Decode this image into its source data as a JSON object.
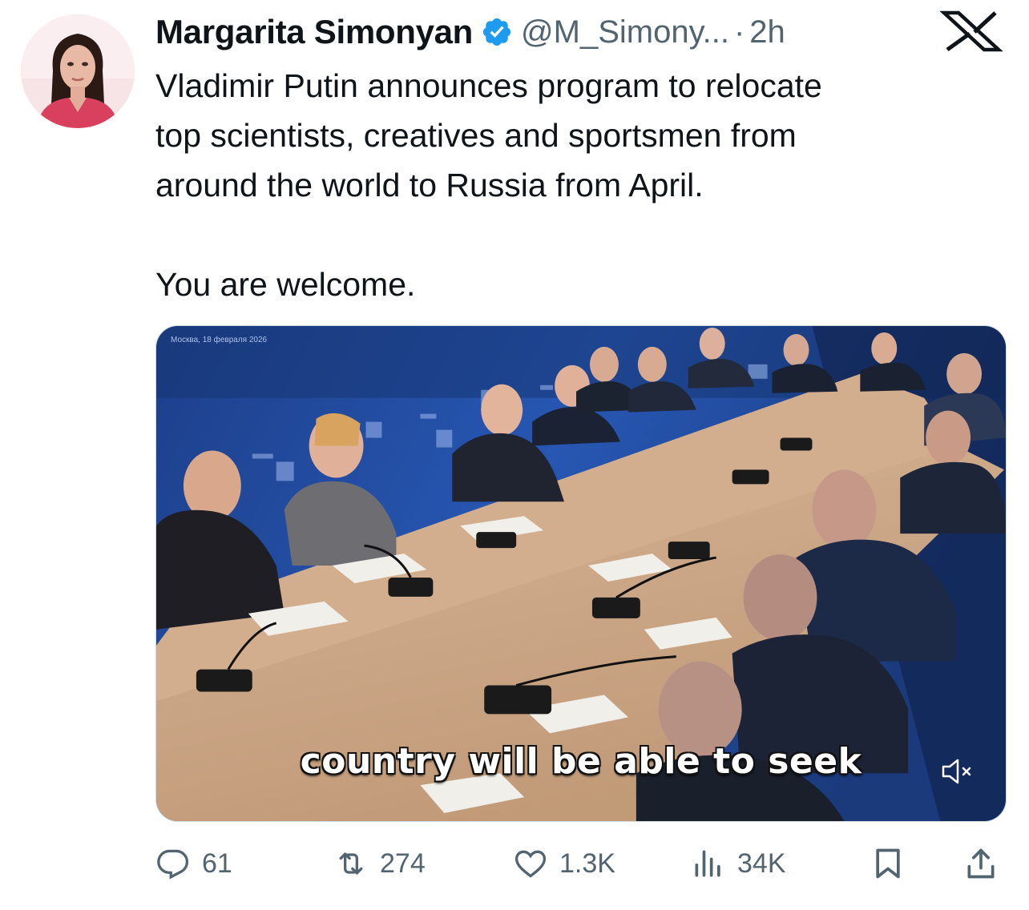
{
  "tweet": {
    "author_name": "Margarita Simonyan",
    "handle": "@M_Simony...",
    "separator": "·",
    "time": "2h",
    "text_lines": [
      "Vladimir Putin announces program to relocate",
      "top scientists, creatives and sportsmen from",
      "around the world to Russia from April."
    ],
    "text_closing": "You are welcome.",
    "verified": true
  },
  "media": {
    "type": "video",
    "subtitle": "country will be able to seek",
    "muted": true,
    "date_stamp": "Москва, 18 февраля 2026"
  },
  "actions": {
    "replies": "61",
    "reposts": "274",
    "likes": "1.3K",
    "views": "34K"
  },
  "icons": {
    "verified": "verified-badge-icon",
    "platform": "x-logo-icon",
    "reply": "reply-icon",
    "repost": "repost-icon",
    "like": "heart-icon",
    "views": "views-icon",
    "bookmark": "bookmark-icon",
    "share": "share-icon",
    "mute": "speaker-muted-icon"
  },
  "colors": {
    "verified_blue": "#1d9bf0",
    "text": "#0f1419",
    "secondary": "#536471"
  }
}
